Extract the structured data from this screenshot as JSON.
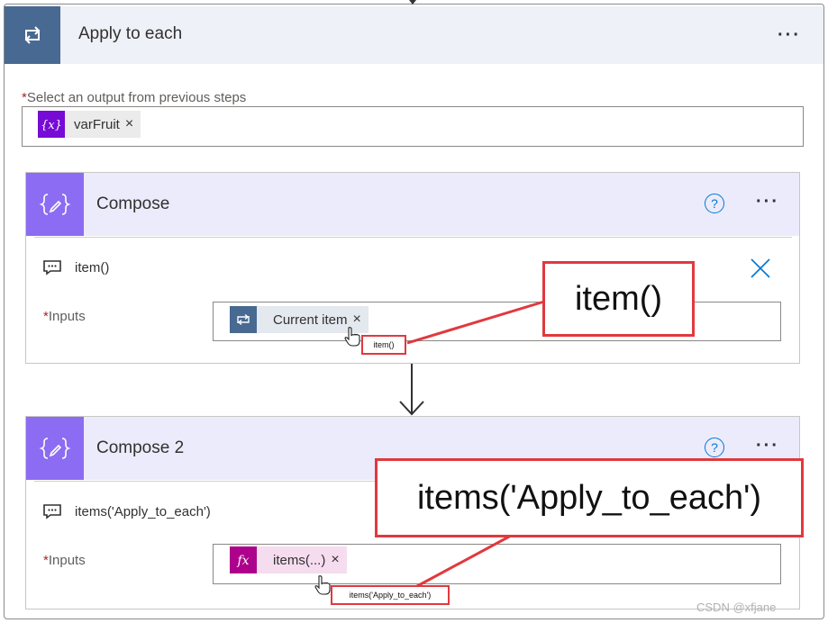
{
  "apply_to_each": {
    "title": "Apply to each",
    "more_label": "···",
    "select_label": "Select an output from previous steps",
    "required_marker": "*",
    "variable_token": {
      "label": "varFruit",
      "remove_label": "×",
      "icon": "variable-icon",
      "color": "#770bd6"
    }
  },
  "compose_1": {
    "title": "Compose",
    "help_label": "?",
    "more_label": "···",
    "comment": "item()",
    "inputs_label": "Inputs",
    "required_marker": "*",
    "token": {
      "label": "Current item",
      "remove_label": "×",
      "icon": "loop-icon",
      "color": "#486991"
    },
    "tooltip": "item()",
    "close_label": "✕"
  },
  "compose_2": {
    "title": "Compose 2",
    "help_label": "?",
    "more_label": "···",
    "comment": "items('Apply_to_each')",
    "inputs_label": "Inputs",
    "required_marker": "*",
    "token": {
      "label": "items(...)",
      "remove_label": "×",
      "icon": "fx-icon",
      "color": "#ad008c"
    },
    "tooltip": "items('Apply_to_each')"
  },
  "callouts": {
    "item_callout": "item()",
    "items_callout": "items('Apply_to_each')"
  },
  "watermark": "CSDN @xfjane",
  "colors": {
    "loop_header": "#486991",
    "compose_accent": "#8c6cf2",
    "callout_red": "#e0393e",
    "link_blue": "#0078d4"
  }
}
